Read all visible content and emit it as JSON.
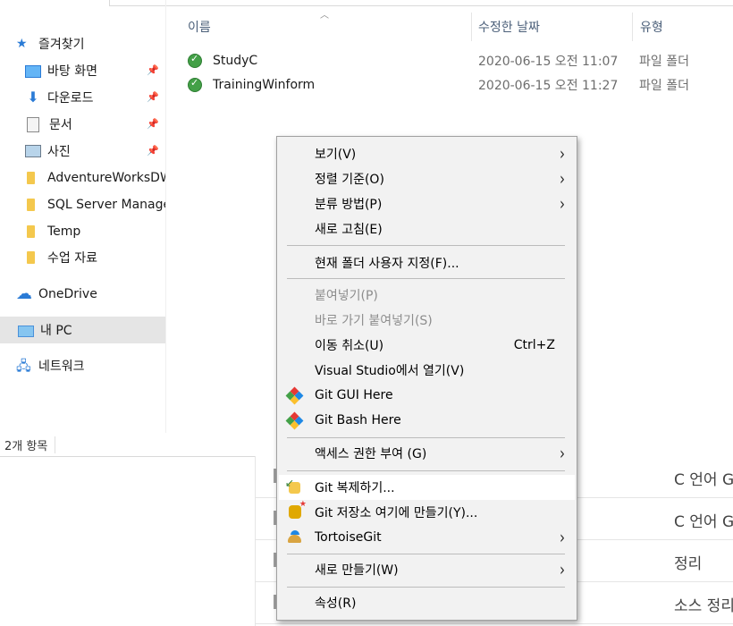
{
  "explorer": {
    "nav": {
      "quick_access": "즐겨찾기",
      "items": [
        {
          "label": "바탕 화면",
          "icon": "desktop-icon",
          "pinned": true
        },
        {
          "label": "다운로드",
          "icon": "download-icon",
          "pinned": true
        },
        {
          "label": "문서",
          "icon": "document-icon",
          "pinned": true
        },
        {
          "label": "사진",
          "icon": "picture-icon",
          "pinned": true
        },
        {
          "label": "AdventureWorksDW",
          "icon": "folder-icon",
          "pinned": false
        },
        {
          "label": "SQL Server Manage",
          "icon": "folder-icon",
          "pinned": false
        },
        {
          "label": "Temp",
          "icon": "folder-icon",
          "pinned": false
        },
        {
          "label": "수업 자료",
          "icon": "folder-icon",
          "pinned": false
        }
      ],
      "onedrive": "OneDrive",
      "this_pc": "내 PC",
      "network": "네트워크"
    },
    "columns": {
      "name": "이름",
      "date": "수정한 날짜",
      "type": "유형"
    },
    "files": [
      {
        "name": "StudyC",
        "date": "2020-06-15 오전 11:07",
        "type": "파일 폴더"
      },
      {
        "name": "TrainingWinform",
        "date": "2020-06-15 오전 11:27",
        "type": "파일 폴더"
      }
    ],
    "status": "2개 항목"
  },
  "background_rows": [
    "C 언어 G",
    "C 언어 G",
    "정리",
    "소스 정리"
  ],
  "context_menu": {
    "view": "보기(V)",
    "sort": "정렬 기준(O)",
    "group": "분류 방법(P)",
    "refresh": "새로 고침(E)",
    "customize": "현재 폴더 사용자 지정(F)...",
    "paste": "붙여넣기(P)",
    "paste_shortcut": "바로 가기 붙여넣기(S)",
    "undo_move": "이동 취소(U)",
    "undo_shortcut": "Ctrl+Z",
    "open_vs": "Visual Studio에서 열기(V)",
    "git_gui": "Git GUI Here",
    "git_bash": "Git Bash Here",
    "give_access": "액세스 권한 부여 (G)",
    "git_clone": "Git 복제하기...",
    "git_create_repo": "Git 저장소 여기에 만들기(Y)...",
    "tortoisegit": "TortoiseGit",
    "new": "새로 만들기(W)",
    "properties": "속성(R)"
  },
  "colors": {
    "menu_bg": "#f2f2f2",
    "hover_bg": "#ffffff",
    "selected_nav_bg": "#e5e5e5",
    "header_text": "#4c607a"
  }
}
